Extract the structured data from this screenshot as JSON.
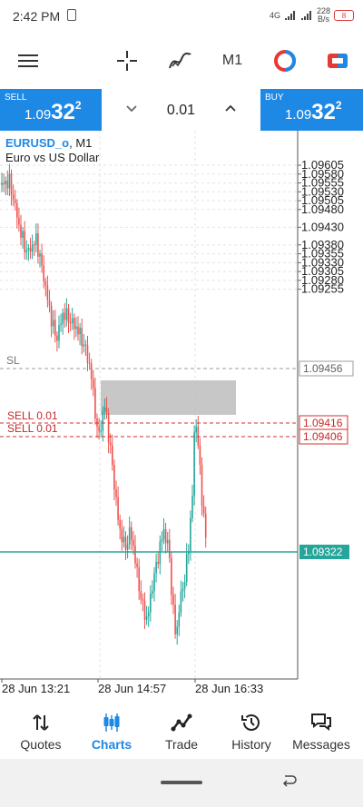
{
  "status_bar": {
    "time": "2:42 PM",
    "network": "4G",
    "speed_value": "228",
    "speed_unit": "B/s",
    "battery": "8"
  },
  "toolbar": {
    "timeframe": "M1"
  },
  "trade_panel": {
    "sell": {
      "label": "SELL",
      "price_prefix": "1.09",
      "price_big": "32",
      "price_sup": "2"
    },
    "lot": "0.01",
    "buy": {
      "label": "BUY",
      "price_prefix": "1.09",
      "price_big": "32",
      "price_sup": "2"
    }
  },
  "chart": {
    "symbol": "EURUSD_o",
    "timeframe": "M1",
    "description": "Euro vs US Dollar",
    "price_levels": [
      "1.09605",
      "1.09580",
      "1.09555",
      "1.09530",
      "1.09505",
      "1.09480",
      "1.09430",
      "1.09380",
      "1.09355",
      "1.09330",
      "1.09305",
      "1.09280",
      "1.09255"
    ],
    "markers": {
      "sl": {
        "label": "SL",
        "price": "1.09456"
      },
      "sell1": {
        "label": "SELL 0.01",
        "price": "1.09416"
      },
      "sell2": {
        "label": "SELL 0.01",
        "price": "1.09406"
      },
      "bid": {
        "price": "1.09322"
      }
    },
    "time_labels": [
      "28 Jun 13:21",
      "28 Jun 14:57",
      "28 Jun 16:33"
    ],
    "colors": {
      "bull": "#26a69a",
      "bear": "#ef5350",
      "bid": "#26a69a",
      "sl": "#9e9e9e",
      "order": "#d32f2f"
    }
  },
  "tabs": [
    {
      "label": "Quotes",
      "icon": "quotes-icon"
    },
    {
      "label": "Charts",
      "icon": "charts-icon",
      "active": true
    },
    {
      "label": "Trade",
      "icon": "trade-icon"
    },
    {
      "label": "History",
      "icon": "history-icon"
    },
    {
      "label": "Messages",
      "icon": "messages-icon"
    }
  ]
}
